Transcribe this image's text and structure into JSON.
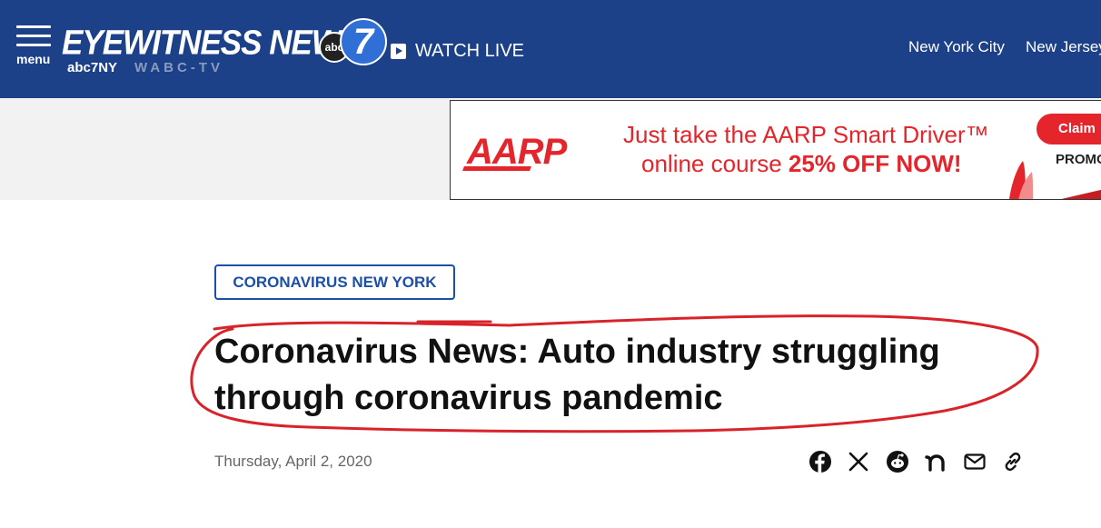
{
  "header": {
    "menu_label": "menu",
    "logo_text": "EYEWITNESS NEWS",
    "logo_abc": "abc",
    "logo_seven": "7",
    "logo_sub_left": "abc7NY",
    "logo_sub_right": "WABC-TV",
    "watch_live": "WATCH LIVE",
    "nav": [
      "New York City",
      "New Jersey"
    ]
  },
  "ad": {
    "brand": "AARP",
    "line1": "Just take the AARP Smart Driver™",
    "line2_prefix": "online course ",
    "line2_bold": "25% OFF NOW!",
    "cta": "Claim",
    "promo": "PROMO"
  },
  "article": {
    "tag": "CORONAVIRUS NEW YORK",
    "headline": "Coronavirus News: Auto industry struggling through coronavirus pandemic",
    "date": "Thursday, April 2, 2020"
  },
  "share_icons": [
    "facebook-icon",
    "x-icon",
    "reddit-icon",
    "nextdoor-icon",
    "email-icon",
    "link-icon"
  ],
  "colors": {
    "header_bg": "#1c4189",
    "tag_blue": "#1c4fa8",
    "aarp_red": "#e4252b",
    "annotation_red": "#d9232b"
  }
}
